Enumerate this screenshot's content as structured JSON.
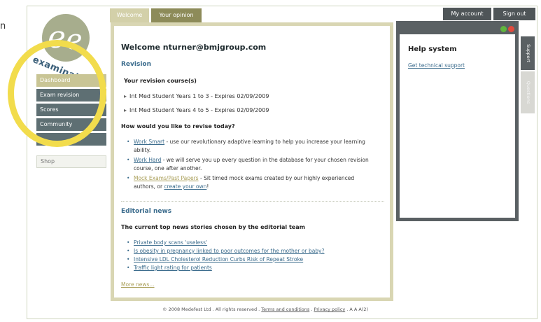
{
  "stray_letter": "n",
  "logo": {
    "text": "examination"
  },
  "tabs": [
    {
      "label": "Welcome"
    },
    {
      "label": "Your opinion"
    }
  ],
  "top_buttons": {
    "account": "My account",
    "signout": "Sign out"
  },
  "nav": {
    "items": [
      {
        "label": "Dashboard"
      },
      {
        "label": "Exam revision"
      },
      {
        "label": "Scores"
      },
      {
        "label": "Community"
      }
    ],
    "shop": "Shop"
  },
  "main": {
    "welcome": "Welcome nturner@bmjgroup.com",
    "revision_heading": "Revision",
    "course_heading": "Your revision course(s)",
    "courses": [
      "Int Med Student Years 1 to 3 - Expires 02/09/2009",
      "Int Med Student Years 4 to 5 - Expires 02/09/2009"
    ],
    "how_heading": "How would you like to revise today?",
    "options": [
      {
        "link": "Work Smart",
        "text": " - use our revolutionary adaptive learning to help you increase your learning ability."
      },
      {
        "link": "Work Hard",
        "text": " - we will serve you up every question in the database for your chosen revision course, one after another."
      },
      {
        "link": "Mock Exams/Past Papers",
        "text": " - Sit timed mock exams created by our highly experienced authors, or ",
        "link2": "create your own",
        "text2": "!"
      }
    ],
    "editorial_heading": "Editorial news",
    "top_stories": "The current top news stories chosen by the editorial team",
    "news": [
      "Private body scans 'useless'",
      "Is obesity in pregnancy linked to poor outcomes for the mother or baby?",
      "Intensive LDL Cholesterol Reduction Curbs Risk of Repeat Stroke",
      "Traffic light rating for patients"
    ],
    "more_news": "More news..."
  },
  "footer": {
    "copyright": "© 2008 Medefest Ltd . All rights reserved . ",
    "terms": "Terms and conditions",
    "sep": " . ",
    "privacy": "Privacy policy",
    "sizes": " . A A A(2)"
  },
  "help": {
    "title": "Help system",
    "link": "Get technical support",
    "side_tabs": [
      "Support",
      "Questions"
    ]
  },
  "colors": {
    "highlight_ring": "#f2dc4c",
    "nav_active": "#c9c595",
    "nav_item": "#5e6f73",
    "link": "#3a6b8c",
    "heading_blue": "#3a6b8c"
  }
}
